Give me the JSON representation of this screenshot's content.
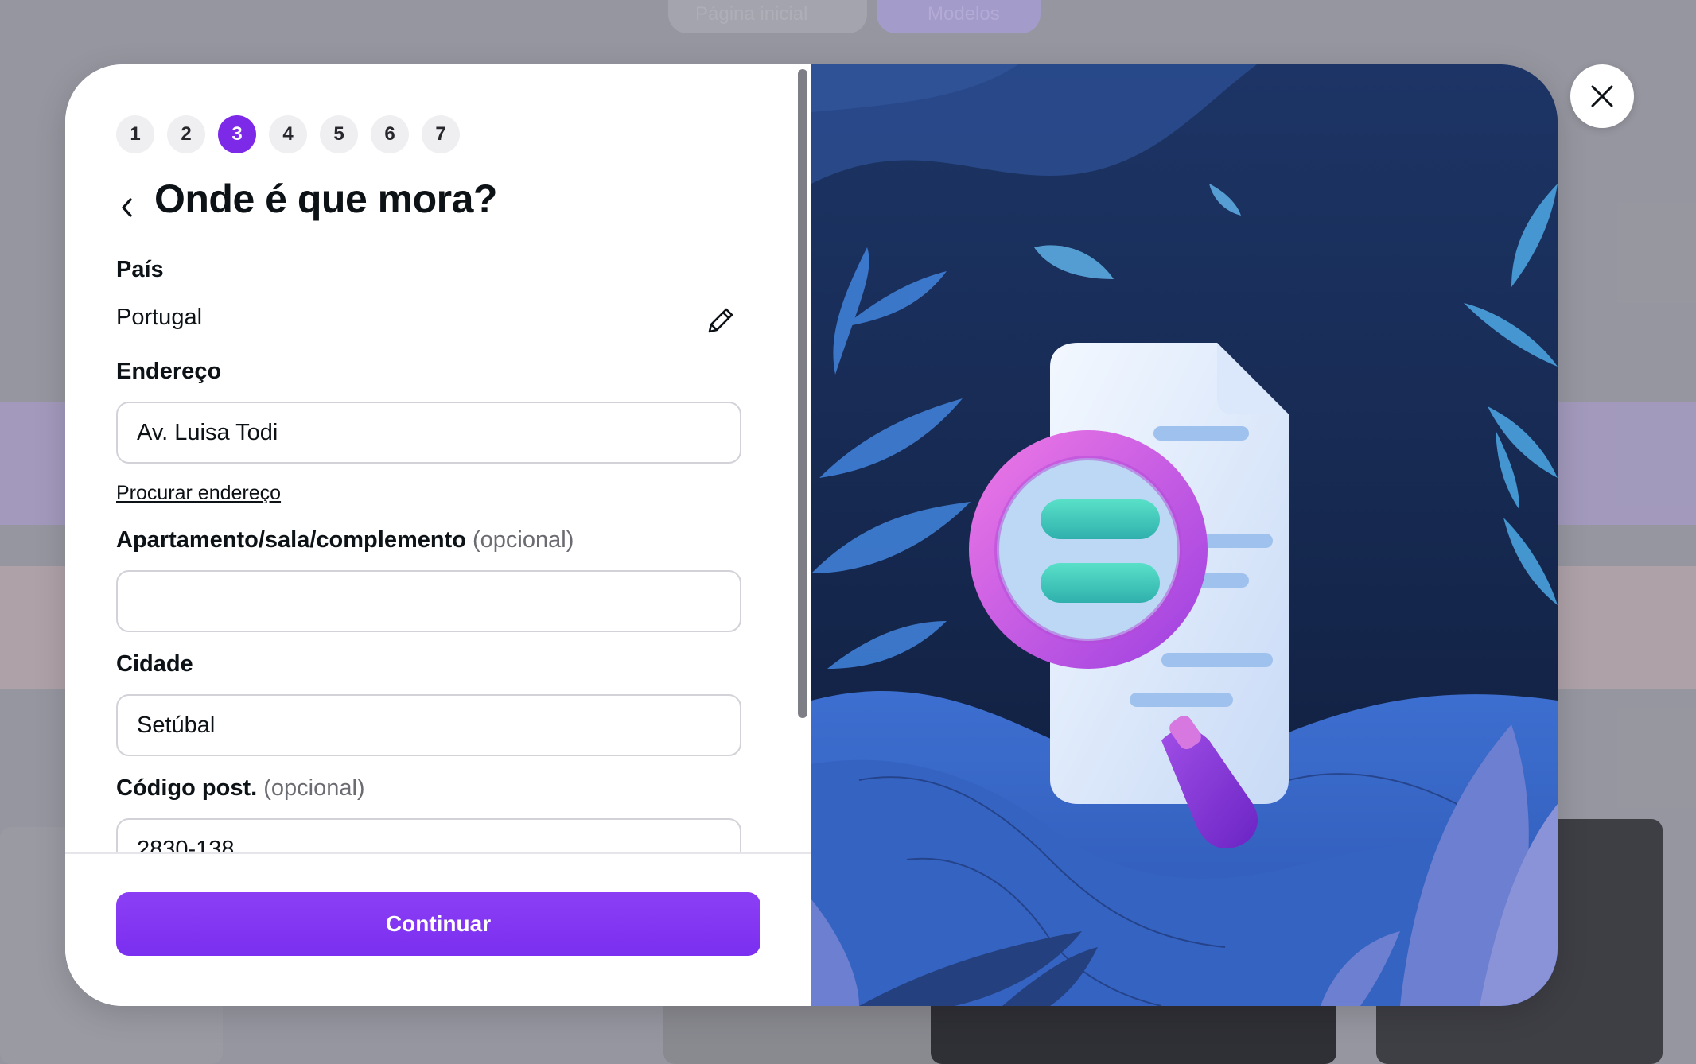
{
  "background": {
    "nav_items": [
      "Página inicial",
      "Modelos"
    ]
  },
  "stepper": {
    "steps": [
      "1",
      "2",
      "3",
      "4",
      "5",
      "6",
      "7"
    ],
    "active_step": 3
  },
  "form": {
    "title": "Onde é que mora?",
    "country": {
      "label": "País",
      "value": "Portugal"
    },
    "address": {
      "label": "Endereço",
      "value": "Av. Luisa Todi",
      "lookup_link": "Procurar endereço"
    },
    "apartment": {
      "label": "Apartamento/sala/complemento",
      "optional": "(opcional)",
      "value": ""
    },
    "city": {
      "label": "Cidade",
      "value": "Setúbal"
    },
    "postal": {
      "label": "Código post.",
      "optional": "(opcional)",
      "value": "2830-138"
    }
  },
  "footer": {
    "continue_label": "Continuar"
  },
  "colors": {
    "accent": "#7d2ae8",
    "illustration_bg": "#142445",
    "magnifier": "#c45ae8"
  },
  "icons": [
    "chevron-left-icon",
    "pencil-icon",
    "close-icon"
  ]
}
